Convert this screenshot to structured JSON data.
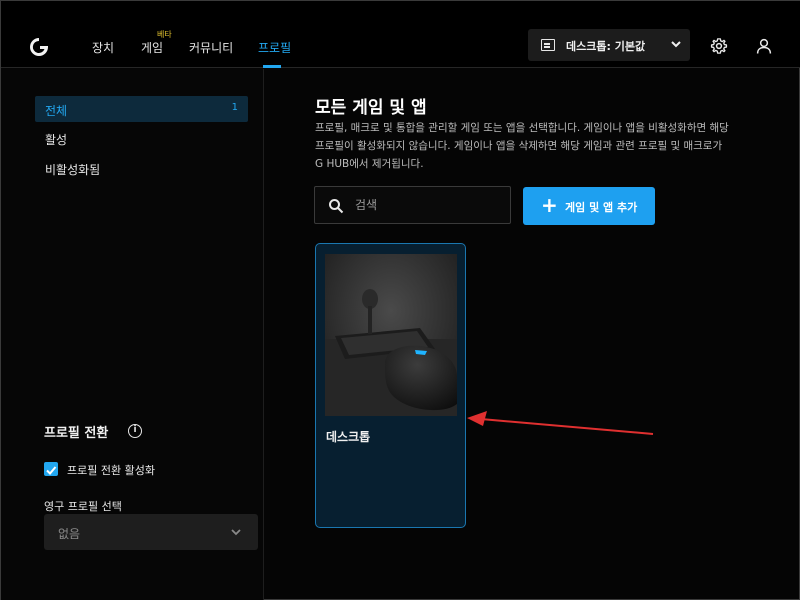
{
  "window": {
    "controls": {
      "minimize": "—",
      "maximize": "□",
      "close": "✕"
    }
  },
  "header": {
    "logo": "logitech-g-logo",
    "nav": [
      {
        "label": "장치"
      },
      {
        "label": "게임",
        "badge": "베타"
      },
      {
        "label": "커뮤니티"
      },
      {
        "label": "프로필",
        "active": true
      }
    ],
    "profile_selector": {
      "label": "데스크톱: 기본값"
    },
    "icons": [
      "gear-icon",
      "user-icon"
    ]
  },
  "sidebar": {
    "items": [
      {
        "label": "전체",
        "count": "1",
        "active": true
      },
      {
        "label": "활성"
      },
      {
        "label": "비활성화됨"
      }
    ],
    "profile_switch": {
      "title": "프로필 전환",
      "checkbox_label": "프로필 전환 활성화",
      "checked": true,
      "permanent_label": "영구 프로필 선택",
      "permanent_value": "없음"
    }
  },
  "main": {
    "title": "모든 게임 및 앱",
    "description_lines": [
      "프로필, 매크로 및 통합을 관리할 게임 또는 앱을 선택합니다. 게임이나 앱을 비활성화하면 해당",
      "프로필이 활성화되지 않습니다. 게임이나 앱을 삭제하면 해당 게임과 관련 프로필 및 매크로가",
      "G HUB에서 제거됩니다."
    ],
    "search": {
      "placeholder": "검색",
      "value": ""
    },
    "add_button": {
      "label": "게임 및 앱 추가"
    },
    "cards": [
      {
        "name": "데스크톱"
      }
    ]
  },
  "colors": {
    "accent": "#22a7f0",
    "button": "#1ea0f0",
    "background": "#050505",
    "card_bg": "#071f30",
    "annotation_arrow": "#e03030"
  }
}
